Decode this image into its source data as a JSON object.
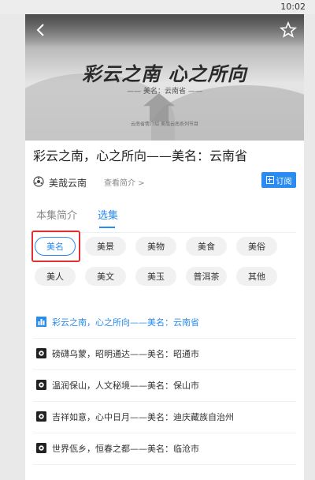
{
  "status": {
    "time": "10:02"
  },
  "banner": {
    "headline": "彩云之南 心之所向",
    "subtitle": "—— 美名：云南省 ——",
    "caption": "云南省情介绍 美哉云南系列节目"
  },
  "program": {
    "title": "彩云之南，心之所向——美名：云南省",
    "author": "美哉云南",
    "intro_link": "查看简介 >",
    "subscribe_label": "订阅"
  },
  "tabs": [
    {
      "label": "本集简介"
    },
    {
      "label": "选集"
    }
  ],
  "categories": [
    {
      "label": "美名",
      "selected": true
    },
    {
      "label": "美景"
    },
    {
      "label": "美物"
    },
    {
      "label": "美食"
    },
    {
      "label": "美俗"
    },
    {
      "label": "美人"
    },
    {
      "label": "美文"
    },
    {
      "label": "美玉"
    },
    {
      "label": "普洱茶"
    },
    {
      "label": "其他"
    }
  ],
  "episodes": [
    {
      "title": "彩云之南，心之所向——美名：云南省",
      "active": true,
      "icon": "playing-bars-icon"
    },
    {
      "title": "磅礴乌蒙，昭明通达——美名：昭通市",
      "icon": "play-icon"
    },
    {
      "title": "温润保山，人文秘境——美名：保山市",
      "icon": "play-icon"
    },
    {
      "title": "吉祥如意，心中日月——美名：迪庆藏族自治州",
      "icon": "play-icon"
    },
    {
      "title": "世界佤乡，恒春之都——美名：临沧市",
      "icon": "play-icon"
    }
  ],
  "colors": {
    "accent": "#2a8cf0",
    "highlight": "#e03030"
  }
}
